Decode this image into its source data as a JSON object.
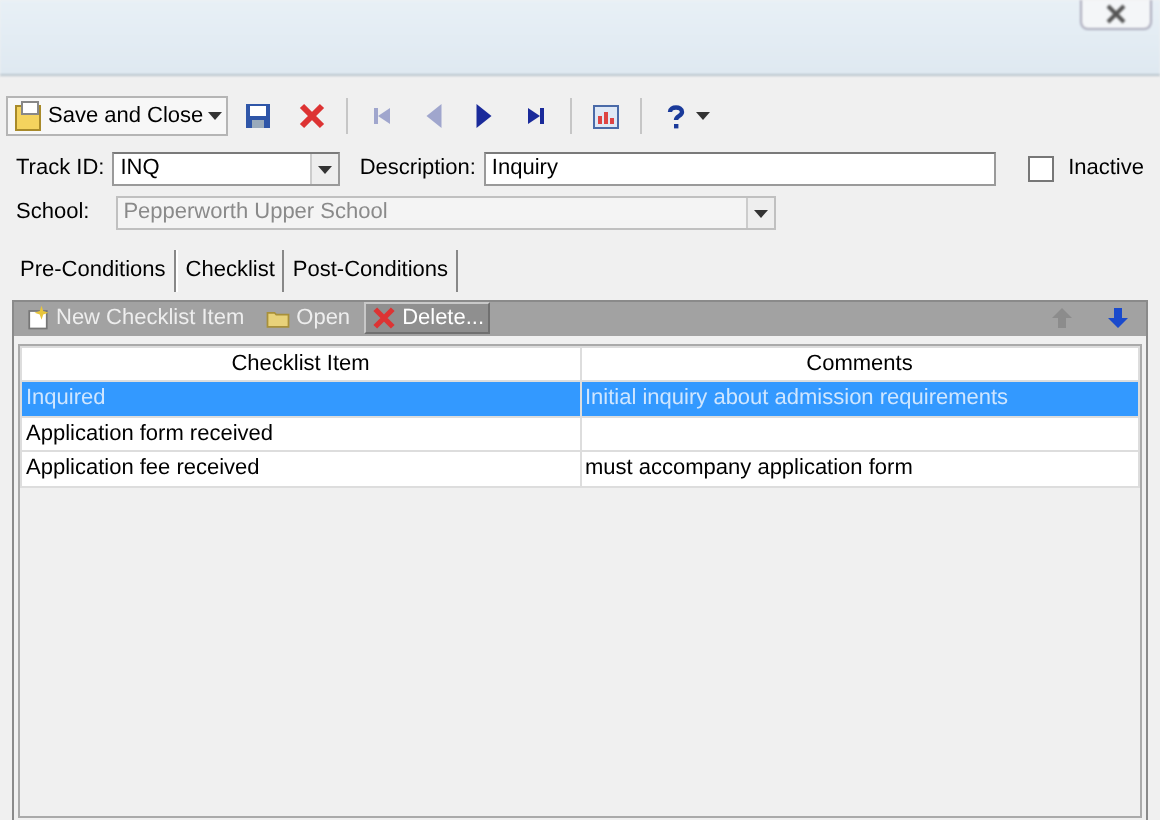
{
  "toolbar": [
    {
      "kind": "save-close",
      "label": "Save and Close",
      "disabled": false
    },
    {
      "kind": "save",
      "disabled": false
    },
    {
      "kind": "delete",
      "disabled": false
    },
    {
      "kind": "separator"
    },
    {
      "kind": "first",
      "disabled": true
    },
    {
      "kind": "prev",
      "disabled": true
    },
    {
      "kind": "next",
      "disabled": false
    },
    {
      "kind": "last",
      "disabled": false
    },
    {
      "kind": "separator"
    },
    {
      "kind": "report",
      "disabled": false
    },
    {
      "kind": "separator"
    },
    {
      "kind": "help",
      "disabled": false
    }
  ],
  "form": {
    "track_id": {
      "label": "Track ID:",
      "value": "INQ"
    },
    "description": {
      "label": "Description:",
      "value": "Inquiry"
    },
    "inactive": {
      "label": "Inactive",
      "checked": false
    },
    "school": {
      "label": "School:",
      "value": "Pepperworth Upper School",
      "disabled": true
    }
  },
  "tabs": [
    {
      "label": "Pre-Conditions",
      "selected": false
    },
    {
      "label": "Checklist",
      "selected": true
    },
    {
      "label": "Post-Conditions",
      "selected": false
    }
  ],
  "grid_toolbar": [
    {
      "kind": "new",
      "label": "New Checklist Item",
      "highlighted": false
    },
    {
      "kind": "open",
      "label": "Open",
      "highlighted": false
    },
    {
      "kind": "delete",
      "label": "Delete...",
      "highlighted": true
    }
  ],
  "move_buttons": [
    {
      "kind": "up",
      "disabled": true
    },
    {
      "kind": "down",
      "disabled": false
    }
  ],
  "table": {
    "columns": [
      "Checklist Item",
      "Comments"
    ],
    "rows": [
      {
        "cells": [
          "Inquired",
          "Initial inquiry about admission requirements"
        ],
        "selected": true
      },
      {
        "cells": [
          "Application form received",
          ""
        ],
        "selected": false
      },
      {
        "cells": [
          "Application fee received",
          "must accompany application form"
        ],
        "selected": false
      }
    ]
  }
}
